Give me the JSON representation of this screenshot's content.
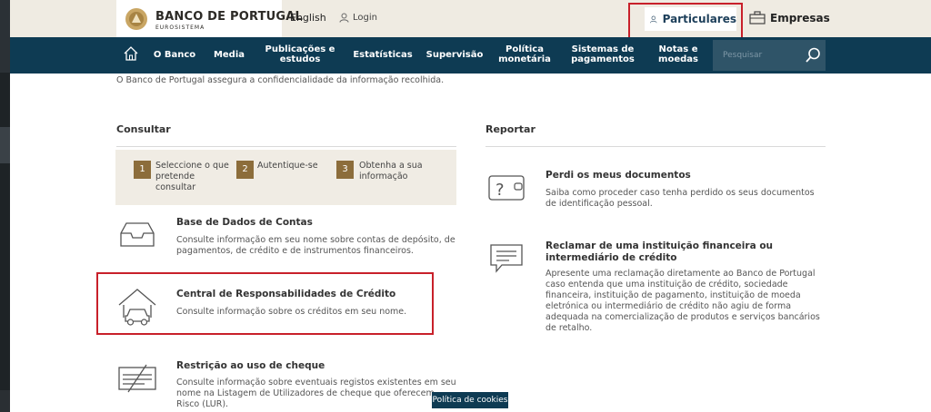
{
  "header": {
    "logo_text": "BANCO DE PORTUGAL",
    "logo_subtext": "EUROSISTEMA",
    "language_link": "English",
    "login_link": "Login",
    "particulares_label": "Particulares",
    "empresas_label": "Empresas"
  },
  "nav": {
    "items": [
      {
        "label": "O Banco"
      },
      {
        "label": "Media"
      },
      {
        "label": "Publicações e estudos"
      },
      {
        "label": "Estatísticas"
      },
      {
        "label": "Supervisão"
      },
      {
        "label": "Política monetária"
      },
      {
        "label": "Sistemas de pagamentos"
      },
      {
        "label": "Notas e moedas"
      }
    ],
    "search_placeholder": "Pesquisar"
  },
  "intro_text": "O Banco de Portugal assegura a confidencialidade da informação recolhida.",
  "consultar": {
    "heading": "Consultar",
    "steps": [
      {
        "number": "1",
        "text": "Seleccione o que pretende consultar"
      },
      {
        "number": "2",
        "text": "Autentique-se"
      },
      {
        "number": "3",
        "text": "Obtenha a sua informação"
      }
    ],
    "items": [
      {
        "title": "Base de Dados de Contas",
        "description": "Consulte informação em seu nome sobre contas de depósito, de pagamentos, de crédito e de instrumentos financeiros."
      },
      {
        "title": "Central de Responsabilidades de Crédito",
        "description": "Consulte informação sobre os créditos em seu nome."
      },
      {
        "title": "Restrição ao uso de cheque",
        "description": "Consulte informação sobre eventuais registos existentes em seu nome na Listagem de Utilizadores de cheque que oferecem Risco (LUR)."
      }
    ]
  },
  "reportar": {
    "heading": "Reportar",
    "items": [
      {
        "title": "Perdi os meus documentos",
        "description": "Saiba como proceder caso tenha perdido os seus documentos de identificação pessoal."
      },
      {
        "title": "Reclamar de uma instituição financeira ou intermediário de crédito",
        "description": "Apresente uma reclamação diretamente ao Banco de Portugal caso entenda que uma instituição de crédito, sociedade financeira, instituição de pagamento, instituição de moeda eletrónica ou intermediário de crédito não agiu de forma adequada na comercialização de  produtos e serviços bancários de retalho."
      }
    ]
  },
  "cookie_link": "Política de cookies",
  "colors": {
    "nav_bg": "#0e3b53",
    "header_bg": "#efebe2",
    "step_badge": "#8c6d3b",
    "highlight": "#c8202a"
  }
}
